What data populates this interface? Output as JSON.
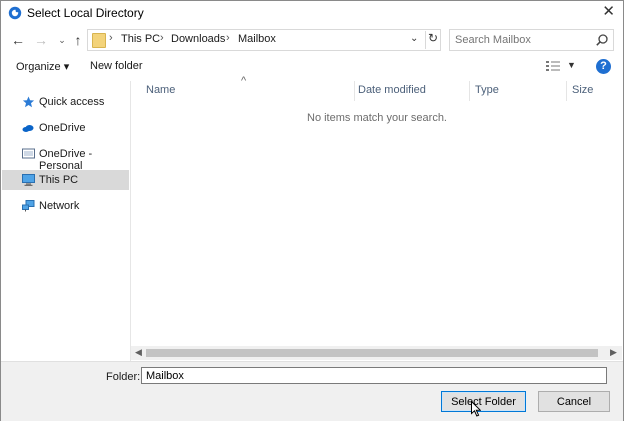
{
  "window": {
    "title": "Select Local Directory"
  },
  "address": {
    "crumbs": [
      "This PC",
      "Downloads",
      "Mailbox"
    ]
  },
  "search": {
    "placeholder": "Search Mailbox"
  },
  "toolbar": {
    "organize_label": "Organize ▾",
    "new_folder_label": "New folder"
  },
  "nav": {
    "items": [
      {
        "label": "Quick access",
        "icon": "star-icon"
      },
      {
        "label": "OneDrive",
        "icon": "cloud-icon"
      },
      {
        "label": "OneDrive - Personal",
        "icon": "cloud-icon"
      },
      {
        "label": "This PC",
        "icon": "computer-icon",
        "selected": true
      },
      {
        "label": "Network",
        "icon": "network-icon"
      }
    ]
  },
  "columns": {
    "name": "Name",
    "date": "Date modified",
    "type": "Type",
    "size": "Size"
  },
  "empty_message": "No items match your search.",
  "footer": {
    "folder_label": "Folder:",
    "folder_value": "Mailbox",
    "select_label": "Select Folder",
    "cancel_label": "Cancel"
  },
  "colors": {
    "accent": "#0078d7",
    "selected_bg": "#d9d9d9",
    "help": "#1f6fd1"
  }
}
